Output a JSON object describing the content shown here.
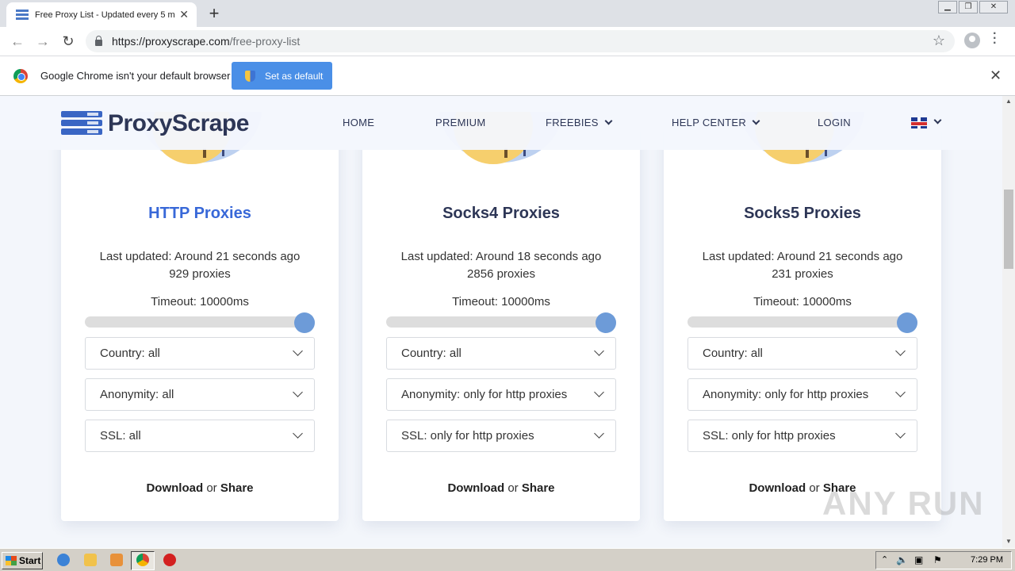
{
  "browser": {
    "tab_title": "Free Proxy List - Updated every 5 m",
    "url_host": "https://proxyscrape.com",
    "url_path": "/free-proxy-list",
    "infobar_text": "Google Chrome isn't your default browser",
    "set_default_label": "Set as default"
  },
  "site": {
    "logo": "ProxyScrape",
    "nav": [
      "HOME",
      "PREMIUM",
      "FREEBIES",
      "HELP CENTER",
      "LOGIN"
    ]
  },
  "cards": [
    {
      "title": "HTTP Proxies",
      "updated": "Last updated: Around 21 seconds ago",
      "count": "929 proxies",
      "timeout": "Timeout: 10000ms",
      "slider_fraction": 1.0,
      "country": "Country: all",
      "anonymity": "Anonymity: all",
      "ssl": "SSL: all",
      "download": "Download",
      "or": "or",
      "share": "Share"
    },
    {
      "title": "Socks4 Proxies",
      "updated": "Last updated: Around 18 seconds ago",
      "count": "2856 proxies",
      "timeout": "Timeout: 10000ms",
      "slider_fraction": 1.0,
      "country": "Country: all",
      "anonymity": "Anonymity: only for http proxies",
      "ssl": "SSL: only for http proxies",
      "download": "Download",
      "or": "or",
      "share": "Share"
    },
    {
      "title": "Socks5 Proxies",
      "updated": "Last updated: Around 21 seconds ago",
      "count": "231 proxies",
      "timeout": "Timeout: 10000ms",
      "slider_fraction": 1.0,
      "country": "Country: all",
      "anonymity": "Anonymity: only for http proxies",
      "ssl": "SSL: only for http proxies",
      "download": "Download",
      "or": "or",
      "share": "Share"
    }
  ],
  "watermark": "ANY RUN",
  "taskbar": {
    "start_label": "Start",
    "clock": "7:29 PM"
  },
  "colors": {
    "accent": "#3868d8",
    "slider_knob": "#6d9bd8",
    "heading": "#2d3656"
  }
}
